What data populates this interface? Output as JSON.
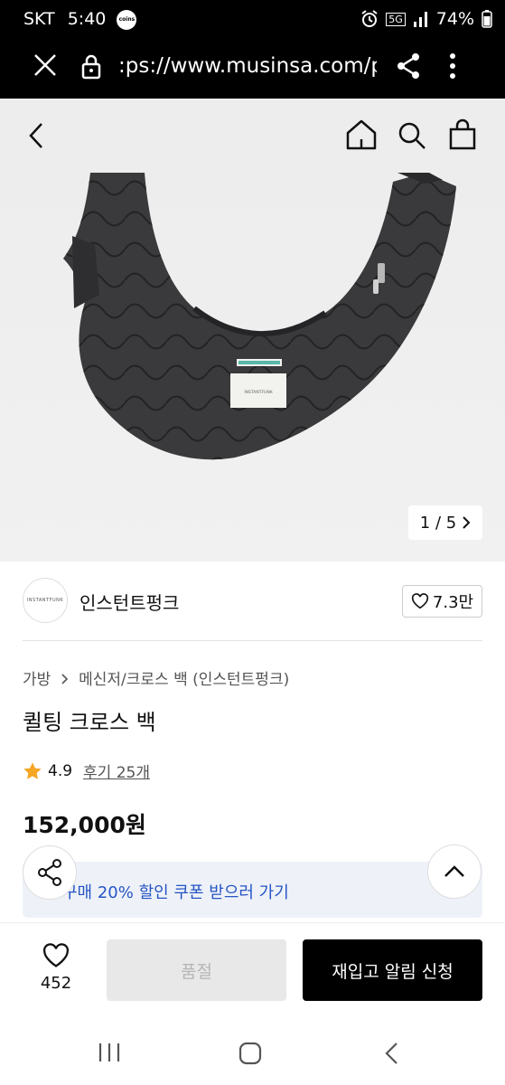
{
  "status_bar": {
    "carrier": "SKT",
    "time": "5:40",
    "app_badge": "coins",
    "network": "5G",
    "battery": "74%"
  },
  "browser": {
    "url": ":ps://www.musinsa.com/p"
  },
  "gallery": {
    "counter": "1 / 5",
    "tag_text": "INSTANTFUNK"
  },
  "brand": {
    "logo_text": "INSTANTFUNK",
    "name": "인스턴트펑크",
    "likes": "7.3만"
  },
  "product": {
    "breadcrumb_category": "가방",
    "breadcrumb_sub": "메신저/크로스 백 (인스턴트펑크)",
    "title": "퀼팅 크로스 백",
    "rating": "4.9",
    "reviews": "후기 25개",
    "price": "152,000원"
  },
  "coupon": {
    "text": "구매 20% 할인 쿠폰 받으러 가기"
  },
  "bottom_bar": {
    "like_count": "452",
    "soldout_label": "품절",
    "notify_label": "재입고 알림 신청"
  },
  "colors": {
    "accent_blue": "#2654c4",
    "star": "#f5a623",
    "black": "#000000"
  }
}
